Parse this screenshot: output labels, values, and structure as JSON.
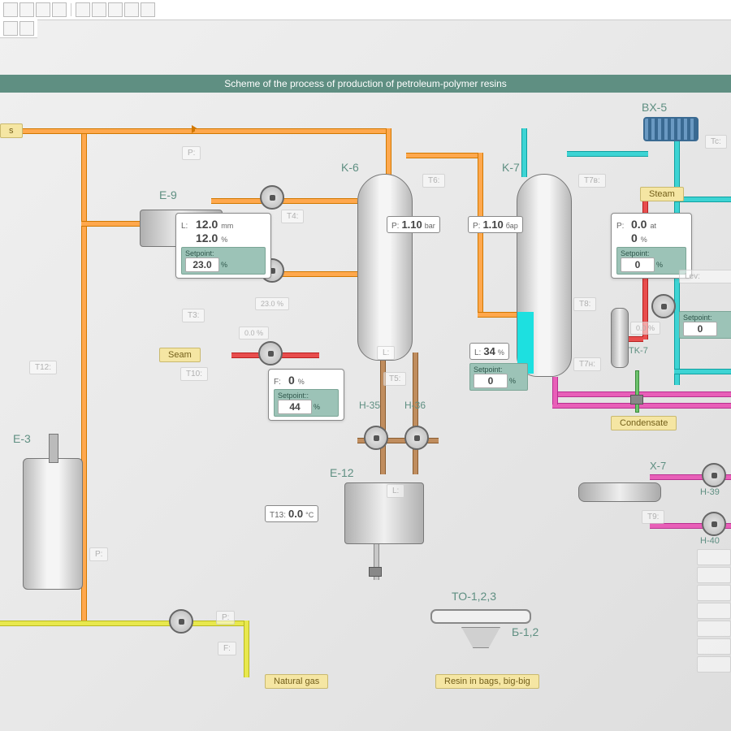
{
  "title": "Scheme of the process of production of petroleum-polymer resins",
  "toolbar_icons": [
    "doc",
    "refresh",
    "line",
    "arrow",
    "|",
    "print",
    "window",
    "tile",
    "cascade",
    "script"
  ],
  "equipment": {
    "e9": "E-9",
    "k6": "K-6",
    "k7": "K-7",
    "bx5": "BX-5",
    "e3": "E-3",
    "h35": "H-35",
    "h36": "H-36",
    "e12": "E-12",
    "x7": "X-7",
    "h39": "H-39",
    "h40": "H-40",
    "tk7": "TK-7",
    "to123": "TO-1,2,3",
    "b12": "Б-1,2"
  },
  "cards": {
    "e9": {
      "L_mm": "12.0",
      "L_mm_u": "mm",
      "L_pct": "12.0",
      "L_pct_u": "%",
      "sp_lbl": "Setpoint:",
      "sp_v": "23.0",
      "sp_u": "%",
      "out": "23.0 %"
    },
    "k7p": {
      "P": "0.0",
      "P_u": "at",
      "pct": "0",
      "pct_u": "%",
      "sp_lbl": "Setpoint:",
      "sp_v": "0",
      "sp_u": "%",
      "out": "0.0 %"
    },
    "f": {
      "F": "0",
      "F_u": "%",
      "sp_lbl": "Setpoint::",
      "sp_v": "44",
      "sp_u": "%",
      "top": "0.0 %"
    },
    "k7l": {
      "L": "34",
      "L_u": "%",
      "sp_lbl": "Setpoint:",
      "sp_v": "0",
      "sp_u": "%"
    },
    "lev": {
      "lbl": "Lev:",
      "sp_lbl": "Setpoint:",
      "sp_v": "0"
    }
  },
  "tags": {
    "k6p": {
      "k": "P:",
      "v": "1.10",
      "u": "bar"
    },
    "k7p": {
      "k": "P:",
      "v": "1.10",
      "u": "бар"
    },
    "t13": {
      "k": "T13:",
      "v": "0.0",
      "u": "°C"
    }
  },
  "faded": {
    "p": "P:",
    "t4": "T4:",
    "t3": "T3:",
    "t12": "T12:",
    "t10": "T10:",
    "f": "F:",
    "l": "L:",
    "t5": "T5:",
    "t6": "T6:",
    "t7v": "T7в:",
    "t8": "T8:",
    "t7n": "T7н:",
    "tc": "Tc:",
    "t9": "T9:",
    "p2": "P:",
    "f2": "F:",
    "p3": "P:"
  },
  "labels": {
    "steam": "Steam",
    "seam": "Seam",
    "natgas": "Natural gas",
    "condensate": "Condensate",
    "resin": "Resin in bags, big-big",
    "s": "s"
  },
  "colors": {
    "orange": "#ffa84d",
    "cyan": "#3dd4d4",
    "magenta": "#e85fb8",
    "yellow": "#e8e84d",
    "red": "#e84d4d",
    "brown": "#c08d5e",
    "teal": "#5f8f82"
  }
}
